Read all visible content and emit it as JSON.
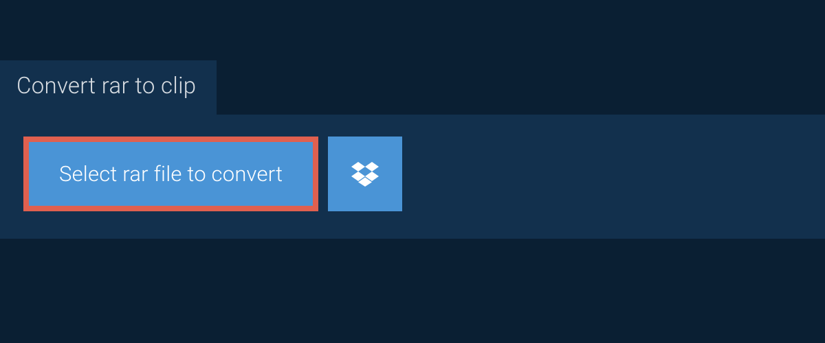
{
  "tab": {
    "title": "Convert rar to clip"
  },
  "actions": {
    "select_file_label": "Select rar file to convert",
    "dropbox_icon_name": "dropbox-icon"
  },
  "colors": {
    "page_bg": "#0a1f33",
    "panel_bg": "#12304d",
    "button_bg": "#4a94d6",
    "button_border": "#e0604f",
    "text_light": "#d8dde2",
    "text_white": "#ffffff"
  }
}
